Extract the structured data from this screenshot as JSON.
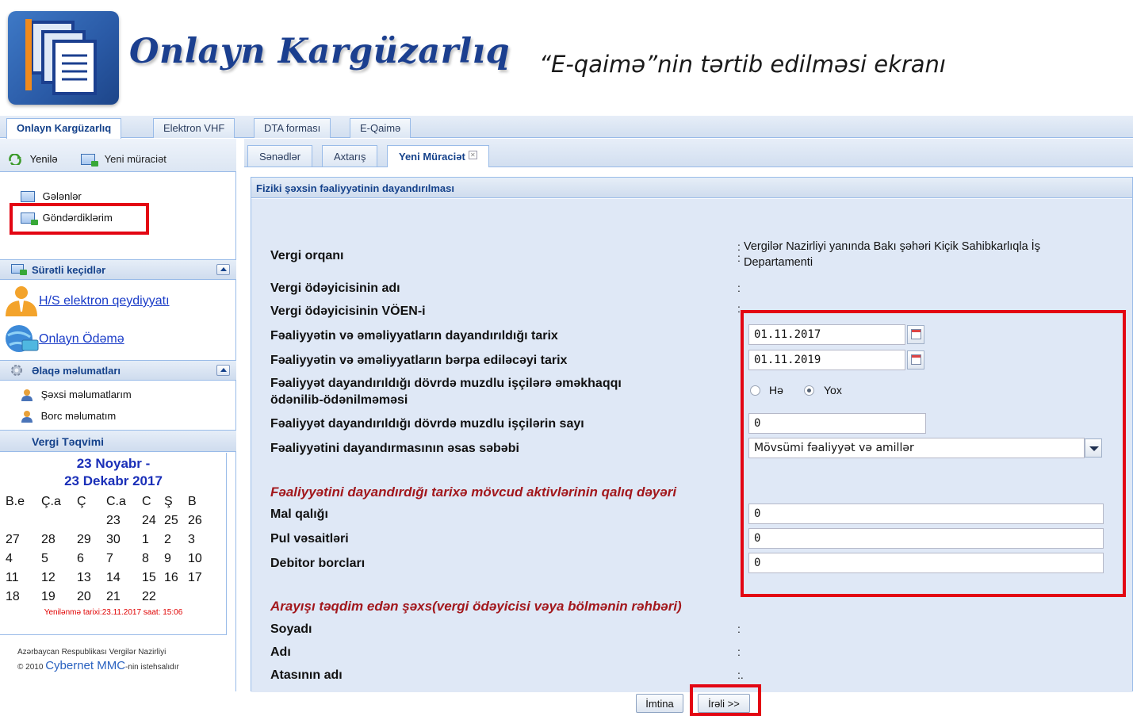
{
  "header": {
    "app_title": "Onlayn Kargüzarlıq",
    "caption": "“E-qaimə”nin tərtib edilməsi ekranı",
    "logo_icon": "documents-stack-icon"
  },
  "top_tabs": [
    "Onlayn Kargüzarlıq",
    "Elektron VHF",
    "DTA forması",
    "E-Qaimə"
  ],
  "sidebar": {
    "toolbar": {
      "refresh_label": "Yenilə",
      "new_request_label": "Yeni müraciət"
    },
    "folders": [
      "Gələnlər",
      "Göndərdiklərim"
    ],
    "quick_links": {
      "title": "Sürətli keçidlər",
      "items": [
        "H/S elektron qeydiyyatı",
        "Onlayn Ödəmə"
      ]
    },
    "contact": {
      "title": "Əlaqə məlumatları",
      "items": [
        "Şəxsi məlumatlarım",
        "Borc məlumatım"
      ]
    },
    "calendar": {
      "title": "Vergi Təqvimi",
      "range_line1": "23 Noyabr -",
      "range_line2": "23 Dekabr 2017",
      "weekdays": [
        "B.e",
        "Ç.a",
        "Ç",
        "C.a",
        "C",
        "Ş",
        "B"
      ],
      "weeks": [
        [
          "",
          "",
          "",
          "23",
          "24",
          "25",
          "26"
        ],
        [
          "27",
          "28",
          "29",
          "30",
          "1",
          "2",
          "3"
        ],
        [
          "4",
          "5",
          "6",
          "7",
          "8",
          "9",
          "10"
        ],
        [
          "11",
          "12",
          "13",
          "14",
          "15",
          "16",
          "17"
        ],
        [
          "18",
          "19",
          "20",
          "21",
          "22",
          "",
          ""
        ]
      ],
      "updated": "Yenilənmə tarixi:23.11.2017 saat: 15:06"
    },
    "footer_line1": "Azərbaycan Respublikası Vergilər Nazirliyi",
    "footer_line2_prefix": "© 2010",
    "footer_brand": "Cybernet MMC",
    "footer_line2_suffix": "-nin istehsalıdır"
  },
  "sub_tabs": [
    "Sənədlər",
    "Axtarış",
    "Yeni Müraciət"
  ],
  "form": {
    "title": "Fiziki şəxsin fəaliyyətinin dayandırılması",
    "fields": {
      "tax_authority_label": "Vergi orqanı",
      "tax_authority_value_line1": "Vergilər Nazirliyi yanında Bakı şəhəri Kiçik Sahibkarlıqla İş",
      "tax_authority_value_line2": "Departamenti",
      "taxpayer_name_label": "Vergi ödəyicisinin adı",
      "taxpayer_voen_label": "Vergi ödəyicisinin VÖEN-i",
      "stop_date_label": "Fəaliyyətin və əməliyyatların dayandırıldığı tarix",
      "stop_date_value": "01.11.2017",
      "resume_date_label": "Fəaliyyətin və əməliyyatların bərpa ediləcəyi tarix",
      "resume_date_value": "01.11.2019",
      "salary_paid_label_line1": "Fəaliyyət dayandırıldığı dövrdə muzdlu işçilərə əməkhaqqı",
      "salary_paid_label_line2": "ödənilib-ödənilməməsi",
      "salary_paid_yes": "Hə",
      "salary_paid_no": "Yox",
      "salary_paid_selected": "Yox",
      "employees_count_label": "Fəaliyyət dayandırıldığı dövrdə muzdlu işçilərin sayı",
      "employees_count_value": "0",
      "reason_label": "Fəaliyyətini dayandırmasının əsas səbəbi",
      "reason_value": "Mövsümi fəaliyyət və amillər"
    },
    "assets_section": {
      "title": "Fəaliyyətini dayandırdığı tarixə mövcud aktivlərinin qalıq dəyəri",
      "goods_label": "Mal qalığı",
      "goods_value": "0",
      "cash_label": "Pul vəsaitləri",
      "cash_value": "0",
      "debtors_label": "Debitor borcları",
      "debtors_value": "0"
    },
    "applicant_section": {
      "title": "Arayışı təqdim edən şəxs(vergi ödəyicisi vəya bölmənin rəhbəri)",
      "surname_label": "Soyadı",
      "name_label": "Adı",
      "patronymic_label": "Atasının adı"
    },
    "buttons": {
      "cancel": "İmtina",
      "next": "İrəli >>"
    }
  },
  "colors": {
    "highlight": "#e30613",
    "panel_header": "#15428b",
    "section_title": "#a2171c",
    "link": "#1a3cc8"
  }
}
